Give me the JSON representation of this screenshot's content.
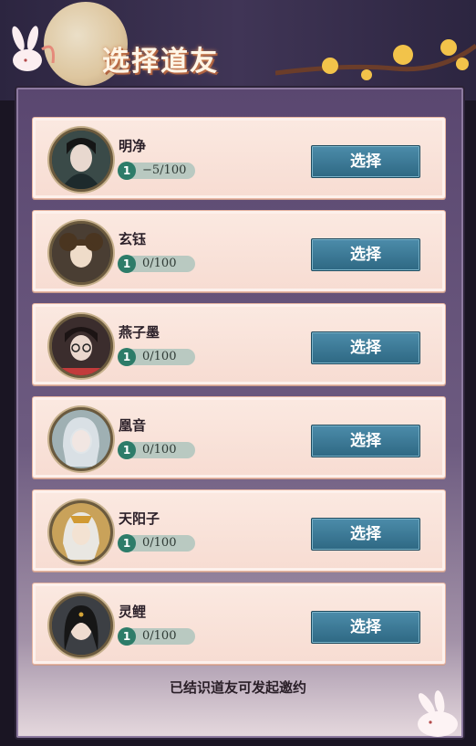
{
  "header": {
    "title": "选择道友"
  },
  "friends": [
    {
      "name": "明净",
      "level": "1",
      "progress": "−5/100",
      "select_label": "选择"
    },
    {
      "name": "玄钰",
      "level": "1",
      "progress": "0/100",
      "select_label": "选择"
    },
    {
      "name": "燕子墨",
      "level": "1",
      "progress": "0/100",
      "select_label": "选择"
    },
    {
      "name": "凰音",
      "level": "1",
      "progress": "0/100",
      "select_label": "选择"
    },
    {
      "name": "天阳子",
      "level": "1",
      "progress": "0/100",
      "select_label": "选择"
    },
    {
      "name": "灵鲤",
      "level": "1",
      "progress": "0/100",
      "select_label": "选择"
    }
  ],
  "footer": {
    "note": "已结识道友可发起邀约"
  },
  "colors": {
    "button": "#3a7896",
    "level_badge": "#2d7c69",
    "card": "#f8e2d8"
  }
}
